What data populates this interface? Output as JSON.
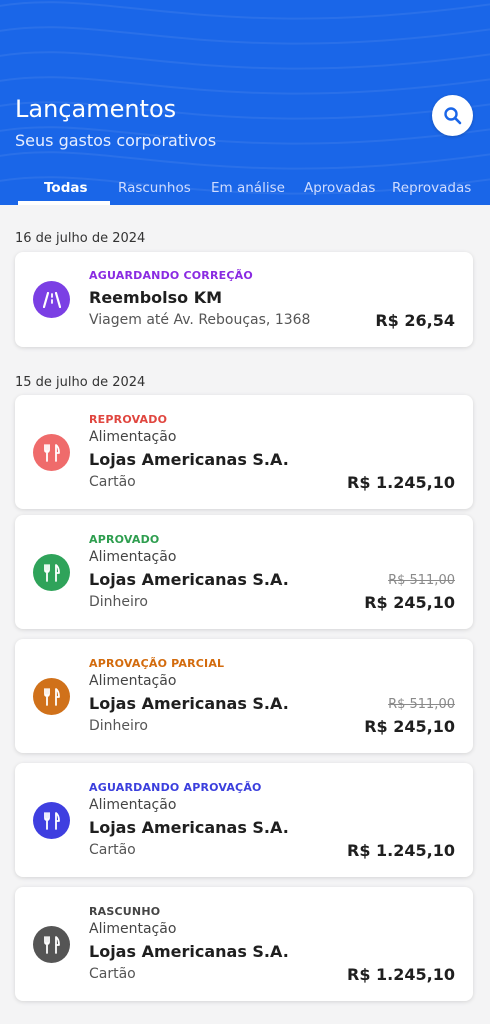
{
  "header": {
    "title": "Lançamentos",
    "subtitle": "Seus gastos corporativos"
  },
  "tabs": [
    {
      "label": "Todas",
      "active": true
    },
    {
      "label": "Rascunhos",
      "active": false
    },
    {
      "label": "Em análise",
      "active": false
    },
    {
      "label": "Aprovadas",
      "active": false
    },
    {
      "label": "Reprovadas",
      "active": false
    }
  ],
  "groups": [
    {
      "date": "16 de julho de 2024",
      "items": [
        {
          "status": "AGUARDANDO CORREÇÃO",
          "status_color": "#8a2be2",
          "icon": "road-icon",
          "icon_bg": "#7b3fe4",
          "title": "Reembolso KM",
          "detail": "Viagem até Av. Rebouças, 1368",
          "amount": "R$ 26,54"
        }
      ]
    },
    {
      "date": "15 de julho de 2024",
      "items": [
        {
          "status": "REPROVADO",
          "status_color": "#e0463f",
          "icon": "fork-knife-icon",
          "icon_bg": "#ef6b6b",
          "category": "Alimentação",
          "title": "Lojas Americanas S.A.",
          "method": "Cartão",
          "amount": "R$ 1.245,10"
        },
        {
          "status": "APROVADO",
          "status_color": "#2e9e4f",
          "icon": "fork-knife-icon",
          "icon_bg": "#2fa35a",
          "category": "Alimentação",
          "title": "Lojas Americanas S.A.",
          "method": "Dinheiro",
          "old_amount": "R$ 511,00",
          "amount": "R$ 245,10"
        },
        {
          "status": "APROVAÇÃO PARCIAL",
          "status_color": "#d36b0d",
          "icon": "fork-knife-icon",
          "icon_bg": "#d0711a",
          "category": "Alimentação",
          "title": "Lojas Americanas S.A.",
          "method": "Dinheiro",
          "old_amount": "R$ 511,00",
          "amount": "R$ 245,10"
        },
        {
          "status": "AGUARDANDO APROVAÇÃO",
          "status_color": "#3b3fdd",
          "icon": "fork-knife-icon",
          "icon_bg": "#3f3fe0",
          "category": "Alimentação",
          "title": "Lojas Americanas S.A.",
          "method": "Cartão",
          "amount": "R$ 1.245,10"
        },
        {
          "status": "RASCUNHO",
          "status_color": "#444444",
          "icon": "fork-knife-icon",
          "icon_bg": "#555555",
          "category": "Alimentação",
          "title": "Lojas Americanas S.A.",
          "method": "Cartão",
          "amount": "R$ 1.245,10"
        }
      ]
    }
  ]
}
